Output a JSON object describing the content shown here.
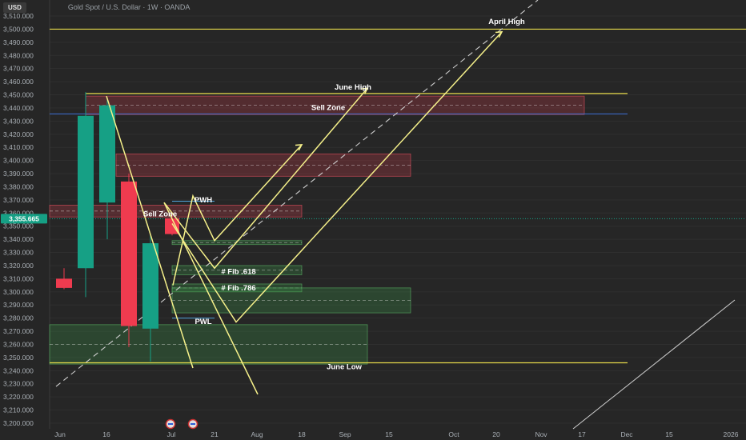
{
  "header": {
    "currency_button": "USD",
    "symbol_title": "Gold Spot / U.S. Dollar · 1W · OANDA"
  },
  "colors": {
    "background": "#262626",
    "bull_candle": "#16a085",
    "bear_candle": "#ef3b4f",
    "key_level": "#e6d94a",
    "projection": "#f5f08a",
    "price_badge": "#16a085"
  },
  "chart_data": {
    "type": "candlestick",
    "title": "Gold Spot / U.S. Dollar · 1W · OANDA",
    "ylim": [
      3195,
      3515
    ],
    "price_ticks": [
      3510,
      3500,
      3490,
      3480,
      3470,
      3460,
      3450,
      3440,
      3430,
      3420,
      3410,
      3400,
      3390,
      3380,
      3370,
      3360,
      3350,
      3340,
      3330,
      3320,
      3310,
      3300,
      3290,
      3280,
      3270,
      3260,
      3250,
      3240,
      3230,
      3220,
      3210,
      3200
    ],
    "price_tick_labels": [
      "3,510.000",
      "3,500.000",
      "3,490.000",
      "3,480.000",
      "3,470.000",
      "3,460.000",
      "3,450.000",
      "3,440.000",
      "3,430.000",
      "3,420.000",
      "3,410.000",
      "3,400.000",
      "3,390.000",
      "3,380.000",
      "3,370.000",
      "3,360.000",
      "3,350.000",
      "3,340.000",
      "3,330.000",
      "3,320.000",
      "3,310.000",
      "3,300.000",
      "3,290.000",
      "3,280.000",
      "3,270.000",
      "3,260.000",
      "3,250.000",
      "3,240.000",
      "3,230.000",
      "3,220.000",
      "3,210.000",
      "3,200.000"
    ],
    "current_price": 3355.665,
    "current_price_label": "3,355.665",
    "x_tick_labels": [
      "Jun",
      "16",
      "Jul",
      "21",
      "Aug",
      "18",
      "Sep",
      "15",
      "Oct",
      "20",
      "Nov",
      "17",
      "Dec",
      "15",
      "2026"
    ],
    "candles": [
      {
        "open": 3310,
        "high": 3318,
        "low": 3302,
        "close": 3303
      },
      {
        "open": 3318,
        "high": 3452,
        "low": 3296,
        "close": 3434
      },
      {
        "open": 3368,
        "high": 3448,
        "low": 3340,
        "close": 3442
      },
      {
        "open": 3384,
        "high": 3390,
        "low": 3258,
        "close": 3274
      },
      {
        "open": 3272,
        "high": 3343,
        "low": 3247,
        "close": 3337
      },
      {
        "open": 3356,
        "high": 3359,
        "low": 3343,
        "close": 3344
      }
    ],
    "levels": [
      {
        "label": "April High",
        "price": 3500
      },
      {
        "label": "June High",
        "price": 3451
      },
      {
        "label": "June Low",
        "price": 3246
      }
    ],
    "zones": [
      {
        "label": "Sell Zone",
        "from": 3435,
        "to": 3449,
        "kind": "supply"
      },
      {
        "label": "",
        "from": 3388,
        "to": 3405,
        "kind": "supply"
      },
      {
        "label": "Sell Zone",
        "from": 3357,
        "to": 3366,
        "kind": "supply"
      },
      {
        "label": "",
        "from": 3336,
        "to": 3339,
        "kind": "demand"
      },
      {
        "label": "Fib .618",
        "from": 3313,
        "to": 3320,
        "kind": "demand"
      },
      {
        "label": "Fib .786",
        "from": 3300,
        "to": 3306,
        "kind": "demand"
      },
      {
        "label": "",
        "from": 3284,
        "to": 3303,
        "kind": "demand"
      },
      {
        "label": "",
        "from": 3245,
        "to": 3275,
        "kind": "demand"
      }
    ],
    "labels": {
      "pwh": "PWH",
      "pwl": "PWL",
      "sell_zone_top": "Sell Zone",
      "sell_zone_mid": "Sell Zone",
      "fib618": "# Fib .618",
      "fib786": "# Fib .786",
      "june_high": "June High",
      "april_high": "April High",
      "june_low": "June Low"
    }
  }
}
